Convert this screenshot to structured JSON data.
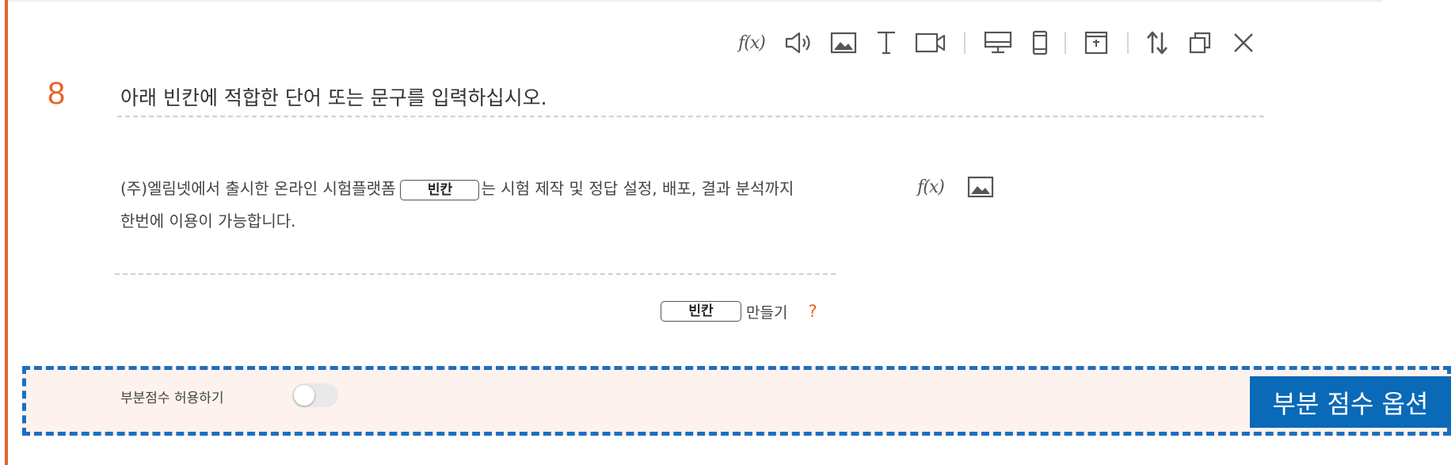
{
  "question": {
    "number": "8",
    "title": "아래 빈칸에 적합한 단어 또는 문구를 입력하십시오."
  },
  "toolbar": {
    "formula_label": "f(x)",
    "icons": [
      "formula-icon",
      "audio-icon",
      "image-icon",
      "text-icon",
      "video-icon",
      "desktop-preview-icon",
      "mobile-preview-icon",
      "layout-icon",
      "reorder-icon",
      "copy-icon",
      "close-icon"
    ]
  },
  "content": {
    "line1_before": "(주)엘림넷에서 출시한 온라인 시험플랫폼",
    "blank_chip": "빈칸",
    "line1_after": "는 시험 제작 및 정답 설정, 배포, 결과 분석까지",
    "line2": "한번에 이용이 가능합니다.",
    "formula_label": "f(x)"
  },
  "make_blank": {
    "chip": "빈칸",
    "label": "만들기",
    "help": "?"
  },
  "partial_score": {
    "label": "부분점수 허용하기",
    "enabled": false,
    "callout": "부분 점수 옵션"
  },
  "colors": {
    "accent": "#e8632a",
    "callout": "#0a6ab8",
    "dashed_border": "#1b6fc2",
    "partial_bg": "#fdf2ee"
  }
}
